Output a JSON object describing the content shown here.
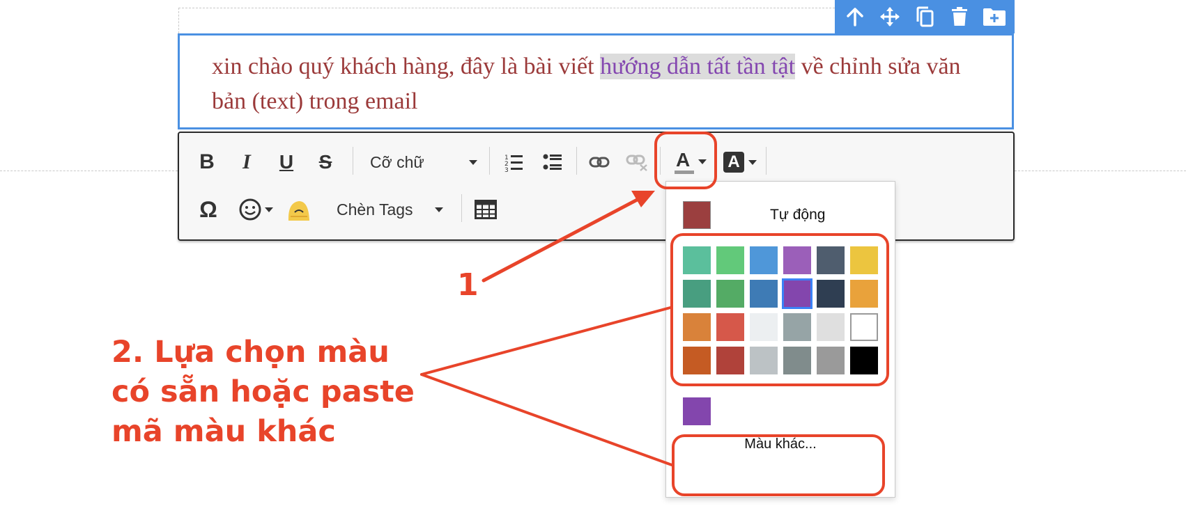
{
  "editor": {
    "text_before": "xin chào quý khách hàng, đây là bài viết ",
    "text_highlight": "hướng dẫn tất tần tật",
    "text_after": " về chỉnh sửa văn bản (text) trong email"
  },
  "action_bar": {
    "icons": [
      "arrow-up-icon",
      "move-icon",
      "copy-icon",
      "trash-icon",
      "add-folder-icon"
    ]
  },
  "toolbar": {
    "bold_label": "B",
    "italic_label": "I",
    "underline_label": "U",
    "strike_label": "S",
    "font_size_label": "Cỡ chữ",
    "text_color_label": "A",
    "bg_color_label": "A",
    "special_char_label": "Ω",
    "insert_tags_label": "Chèn Tags"
  },
  "color_picker": {
    "auto_label": "Tự động",
    "auto_color": "#9b3f3f",
    "palette": [
      [
        "#5bbf9c",
        "#62c97a",
        "#4f97d9",
        "#9b5fb9",
        "#4f5d6e",
        "#ecc53f"
      ],
      [
        "#489e80",
        "#54ab65",
        "#3e7bb5",
        "#8346ad",
        "#2f3e52",
        "#e9a23b"
      ],
      [
        "#d9823a",
        "#d6584a",
        "#eceff1",
        "#96a4a6",
        "#dfdfdf",
        "#ffffff"
      ],
      [
        "#c55b23",
        "#b0423a",
        "#bcc2c5",
        "#808c8c",
        "#9a9a9a",
        "#000000"
      ]
    ],
    "selected_color": "#8346ad",
    "recent_color": "#8346ad",
    "more_colors_label": "Màu khác..."
  },
  "annotations": {
    "step1": "1",
    "step2": "2. Lựa chọn màu có sẵn hoặc paste mã màu khác",
    "accent_color": "#e8442a"
  }
}
